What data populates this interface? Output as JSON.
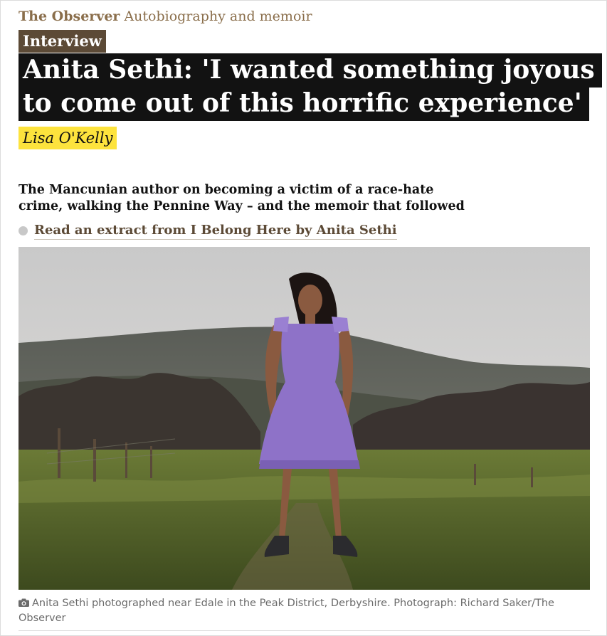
{
  "series": {
    "pillar": "The Observer",
    "section": "Autobiography and memoir"
  },
  "article": {
    "kicker": "Interview",
    "headline": "Anita Sethi: 'I wanted something joyous to come out of this horrific experience'",
    "byline": "Lisa O'Kelly",
    "standfirst": "The Mancunian author on becoming a victim of a race-hate crime, walking the Pennine Way – and the memoir that followed",
    "related_link": "Read an extract from I Belong Here by Anita Sethi"
  },
  "image": {
    "caption": "Anita Sethi photographed near Edale in the Peak District, Derbyshire. Photograph: Richard Saker/The Observer"
  },
  "icons": {
    "caption_icon": "camera-icon",
    "related_icon": "bullet-dot-icon"
  },
  "colors": {
    "pillar": "#8a6e4b",
    "kicker_bg": "#5c4a36",
    "headline_bg": "#121212",
    "byline_bg": "#fde33d",
    "dress": "#8e72c8"
  }
}
